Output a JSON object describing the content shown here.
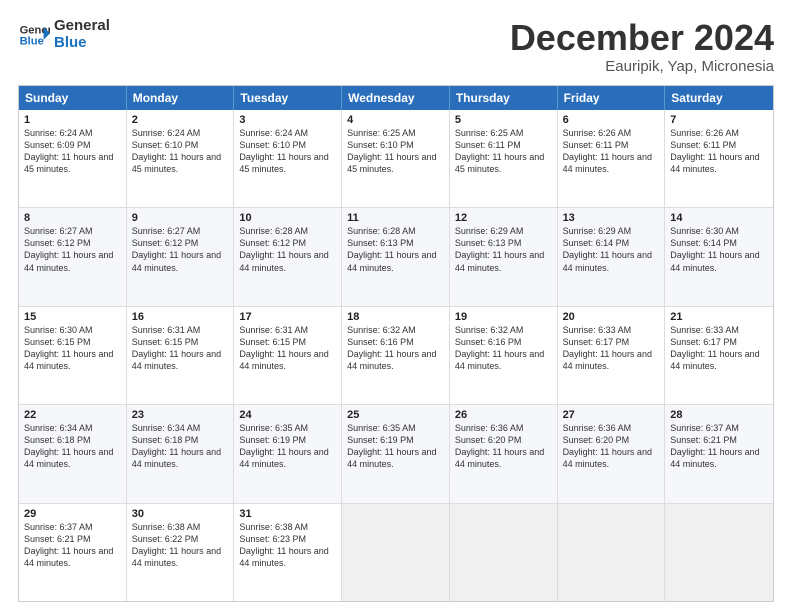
{
  "logo": {
    "text_general": "General",
    "text_blue": "Blue"
  },
  "header": {
    "month": "December 2024",
    "location": "Eauripik, Yap, Micronesia"
  },
  "days_of_week": [
    "Sunday",
    "Monday",
    "Tuesday",
    "Wednesday",
    "Thursday",
    "Friday",
    "Saturday"
  ],
  "weeks": [
    [
      {
        "day": "1",
        "sunrise": "6:24 AM",
        "sunset": "6:09 PM",
        "daylight": "11 hours and 45 minutes."
      },
      {
        "day": "2",
        "sunrise": "6:24 AM",
        "sunset": "6:10 PM",
        "daylight": "11 hours and 45 minutes."
      },
      {
        "day": "3",
        "sunrise": "6:24 AM",
        "sunset": "6:10 PM",
        "daylight": "11 hours and 45 minutes."
      },
      {
        "day": "4",
        "sunrise": "6:25 AM",
        "sunset": "6:10 PM",
        "daylight": "11 hours and 45 minutes."
      },
      {
        "day": "5",
        "sunrise": "6:25 AM",
        "sunset": "6:11 PM",
        "daylight": "11 hours and 45 minutes."
      },
      {
        "day": "6",
        "sunrise": "6:26 AM",
        "sunset": "6:11 PM",
        "daylight": "11 hours and 44 minutes."
      },
      {
        "day": "7",
        "sunrise": "6:26 AM",
        "sunset": "6:11 PM",
        "daylight": "11 hours and 44 minutes."
      }
    ],
    [
      {
        "day": "8",
        "sunrise": "6:27 AM",
        "sunset": "6:12 PM",
        "daylight": "11 hours and 44 minutes."
      },
      {
        "day": "9",
        "sunrise": "6:27 AM",
        "sunset": "6:12 PM",
        "daylight": "11 hours and 44 minutes."
      },
      {
        "day": "10",
        "sunrise": "6:28 AM",
        "sunset": "6:12 PM",
        "daylight": "11 hours and 44 minutes."
      },
      {
        "day": "11",
        "sunrise": "6:28 AM",
        "sunset": "6:13 PM",
        "daylight": "11 hours and 44 minutes."
      },
      {
        "day": "12",
        "sunrise": "6:29 AM",
        "sunset": "6:13 PM",
        "daylight": "11 hours and 44 minutes."
      },
      {
        "day": "13",
        "sunrise": "6:29 AM",
        "sunset": "6:14 PM",
        "daylight": "11 hours and 44 minutes."
      },
      {
        "day": "14",
        "sunrise": "6:30 AM",
        "sunset": "6:14 PM",
        "daylight": "11 hours and 44 minutes."
      }
    ],
    [
      {
        "day": "15",
        "sunrise": "6:30 AM",
        "sunset": "6:15 PM",
        "daylight": "11 hours and 44 minutes."
      },
      {
        "day": "16",
        "sunrise": "6:31 AM",
        "sunset": "6:15 PM",
        "daylight": "11 hours and 44 minutes."
      },
      {
        "day": "17",
        "sunrise": "6:31 AM",
        "sunset": "6:15 PM",
        "daylight": "11 hours and 44 minutes."
      },
      {
        "day": "18",
        "sunrise": "6:32 AM",
        "sunset": "6:16 PM",
        "daylight": "11 hours and 44 minutes."
      },
      {
        "day": "19",
        "sunrise": "6:32 AM",
        "sunset": "6:16 PM",
        "daylight": "11 hours and 44 minutes."
      },
      {
        "day": "20",
        "sunrise": "6:33 AM",
        "sunset": "6:17 PM",
        "daylight": "11 hours and 44 minutes."
      },
      {
        "day": "21",
        "sunrise": "6:33 AM",
        "sunset": "6:17 PM",
        "daylight": "11 hours and 44 minutes."
      }
    ],
    [
      {
        "day": "22",
        "sunrise": "6:34 AM",
        "sunset": "6:18 PM",
        "daylight": "11 hours and 44 minutes."
      },
      {
        "day": "23",
        "sunrise": "6:34 AM",
        "sunset": "6:18 PM",
        "daylight": "11 hours and 44 minutes."
      },
      {
        "day": "24",
        "sunrise": "6:35 AM",
        "sunset": "6:19 PM",
        "daylight": "11 hours and 44 minutes."
      },
      {
        "day": "25",
        "sunrise": "6:35 AM",
        "sunset": "6:19 PM",
        "daylight": "11 hours and 44 minutes."
      },
      {
        "day": "26",
        "sunrise": "6:36 AM",
        "sunset": "6:20 PM",
        "daylight": "11 hours and 44 minutes."
      },
      {
        "day": "27",
        "sunrise": "6:36 AM",
        "sunset": "6:20 PM",
        "daylight": "11 hours and 44 minutes."
      },
      {
        "day": "28",
        "sunrise": "6:37 AM",
        "sunset": "6:21 PM",
        "daylight": "11 hours and 44 minutes."
      }
    ],
    [
      {
        "day": "29",
        "sunrise": "6:37 AM",
        "sunset": "6:21 PM",
        "daylight": "11 hours and 44 minutes."
      },
      {
        "day": "30",
        "sunrise": "6:38 AM",
        "sunset": "6:22 PM",
        "daylight": "11 hours and 44 minutes."
      },
      {
        "day": "31",
        "sunrise": "6:38 AM",
        "sunset": "6:23 PM",
        "daylight": "11 hours and 44 minutes."
      },
      null,
      null,
      null,
      null
    ]
  ],
  "labels": {
    "sunrise": "Sunrise: ",
    "sunset": "Sunset: ",
    "daylight": "Daylight: "
  }
}
